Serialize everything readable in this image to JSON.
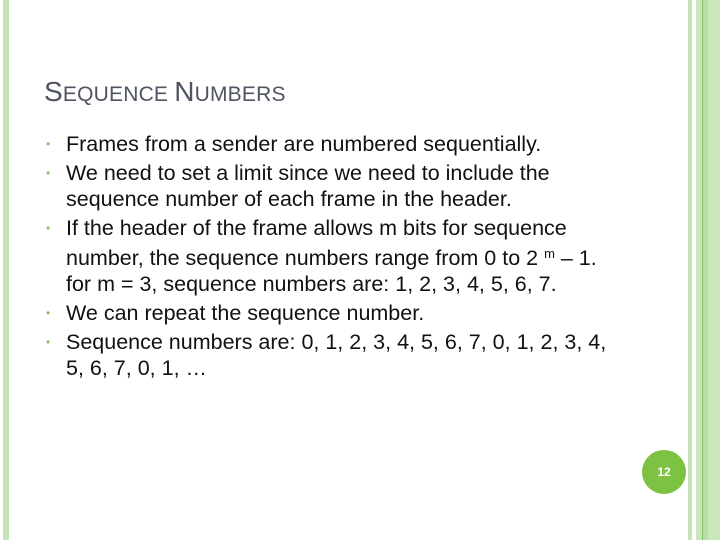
{
  "slide": {
    "title_part1_cap": "S",
    "title_part1_rest": "EQUENCE ",
    "title_part2_cap": "N",
    "title_part2_rest": "UMBERS",
    "bullets": [
      "Frames from a sender are numbered sequentially.",
      "We need to set a limit since we need to include the sequence number of each frame in the header.",
      {
        "before_sup": "If the header of the frame allows m bits for sequence number, the sequence numbers range from 0 to 2 ",
        "sup": "m",
        "after_sup": " – 1. for m = 3, sequence numbers are: 1, 2, 3, 4, 5, 6, 7."
      },
      "We can repeat the sequence number.",
      "Sequence numbers are: 0, 1, 2, 3, 4, 5, 6, 7, 0, 1, 2, 3, 4, 5, 6, 7, 0, 1, …"
    ],
    "bullet_glyph": "•",
    "page_number": "12"
  },
  "colors": {
    "accent_green": "#7dc242",
    "stripe_green": "#c4e4b6",
    "title_gray": "#4e5461"
  }
}
